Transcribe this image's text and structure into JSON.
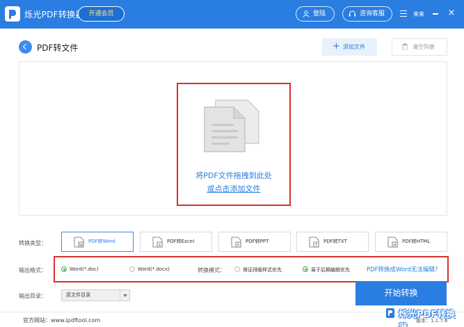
{
  "app": {
    "title": "烁光PDF转换器",
    "vip_label": "开通会员",
    "login_label": "登陆",
    "service_label": "咨询客服",
    "user_name": "来来"
  },
  "header": {
    "page_title": "PDF转文件",
    "add_file_label": "添加文件",
    "clear_list_label": "清空列表"
  },
  "drop_zone": {
    "line1": "将PDF文件拖拽到此处",
    "line2": "或点击添加文件"
  },
  "conversion": {
    "type_label": "转换类型：",
    "types": [
      {
        "label": "PDF转Word",
        "letter": "W",
        "active": true
      },
      {
        "label": "PDF转Excel",
        "letter": "X",
        "active": false
      },
      {
        "label": "PDF转PPT",
        "letter": "P",
        "active": false
      },
      {
        "label": "PDF转TXT",
        "letter": "T",
        "active": false
      },
      {
        "label": "PDF转HTML",
        "letter": "H",
        "active": false
      }
    ]
  },
  "options": {
    "format_label": "输出格式：",
    "format_doc": "Word(*.doc)",
    "format_docx": "Word(*.docx)",
    "mode_label": "转换模式：",
    "mode_layout": "保证排版样式优先",
    "mode_edit": "易于后期编辑优先",
    "help_link": "PDF转换成Word无法编辑？"
  },
  "output": {
    "dir_label": "输出目录：",
    "dir_value": "原文件目录",
    "start_label": "开始转换"
  },
  "footer": {
    "site": "官方网站：www.ipdftool.com",
    "version": "版本：1.1.7.6",
    "watermark": "烁光PDF转换器"
  },
  "colors": {
    "primary": "#2a7de1",
    "highlight_frame": "#d9302c",
    "vip_text": "#ffe87a",
    "radio_checked": "#3ba545"
  }
}
